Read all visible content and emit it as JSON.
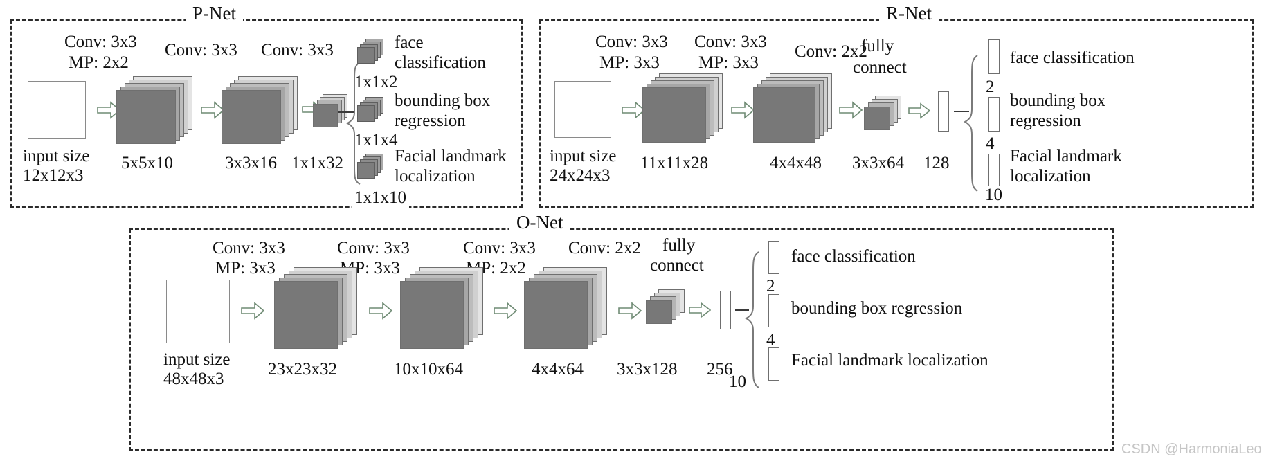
{
  "figure": {
    "watermark": "CSDN @HarmoniaLeo"
  },
  "pnet": {
    "title": "P-Net",
    "ops": [
      {
        "conv": "Conv: 3x3",
        "pool": "MP: 2x2"
      },
      {
        "conv": "Conv: 3x3",
        "pool": ""
      },
      {
        "conv": "Conv: 3x3",
        "pool": ""
      }
    ],
    "input_label_line1": "input size",
    "input_label_line2": "12x12x3",
    "stage_labels": [
      "5x5x10",
      "3x3x16",
      "1x1x32"
    ],
    "outputs": [
      {
        "name": "face\nclassification",
        "name_line1": "face",
        "name_line2": "classification",
        "dims": "1x1x2"
      },
      {
        "name": "bounding box\nregression",
        "name_line1": "bounding box",
        "name_line2": "regression",
        "dims": "1x1x4"
      },
      {
        "name": "Facial landmark\nlocalization",
        "name_line1": "Facial landmark",
        "name_line2": "localization",
        "dims": "1x1x10"
      }
    ]
  },
  "rnet": {
    "title": "R-Net",
    "ops": [
      {
        "conv": "Conv: 3x3",
        "pool": "MP: 3x3"
      },
      {
        "conv": "Conv: 3x3",
        "pool": "MP: 3x3"
      },
      {
        "conv": "Conv: 2x2",
        "pool": ""
      }
    ],
    "fc_label_line1": "fully",
    "fc_label_line2": "connect",
    "input_label_line1": "input size",
    "input_label_line2": "24x24x3",
    "stage_labels": [
      "11x11x28",
      "4x4x48",
      "3x3x64"
    ],
    "fc_size": "128",
    "outputs": [
      {
        "name_line1": "face classification",
        "name_line2": "",
        "size": "2"
      },
      {
        "name_line1": "bounding box",
        "name_line2": "regression",
        "size": "4"
      },
      {
        "name_line1": "Facial landmark",
        "name_line2": "localization",
        "size": "10"
      }
    ]
  },
  "onet": {
    "title": "O-Net",
    "ops": [
      {
        "conv": "Conv: 3x3",
        "pool": "MP: 3x3"
      },
      {
        "conv": "Conv: 3x3",
        "pool": "MP: 3x3"
      },
      {
        "conv": "Conv: 3x3",
        "pool": "MP: 2x2"
      },
      {
        "conv": "Conv: 2x2",
        "pool": ""
      }
    ],
    "fc_label_line1": "fully",
    "fc_label_line2": "connect",
    "input_label_line1": "input size",
    "input_label_line2": "48x48x3",
    "stage_labels": [
      "23x23x32",
      "10x10x64",
      "4x4x64",
      "3x3x128"
    ],
    "fc_size": "256",
    "outputs": [
      {
        "name": "face classification",
        "size": "2"
      },
      {
        "name": "bounding box regression",
        "size": "4"
      },
      {
        "name": "Facial landmark localization",
        "size": "10"
      }
    ]
  },
  "colors": {
    "panel_border": "#2b2b2b",
    "card_front": "#787878",
    "card_back": "#d8d8d8",
    "arrow_stroke": "#6f8b74",
    "arrow_fill": "#ffffff",
    "watermark": "#c6c6c6"
  }
}
